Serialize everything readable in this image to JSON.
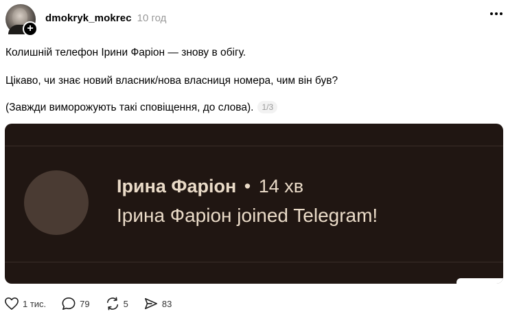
{
  "post": {
    "username": "dmokryk_mokrec",
    "timestamp": "10 год",
    "follow_symbol": "+",
    "lines": [
      "Колишній телефон Ірини Фаріон — знову в обігу.",
      "Цікаво, чи знає новий власник/нова власниця номера, чим він був?",
      "(Завжди виморожують такі сповіщення, до слова)."
    ],
    "pager": "1/3"
  },
  "media": {
    "notification": {
      "sender": "Ірина Фаріон",
      "separator": "•",
      "time": "14 хв",
      "message": "Ірина Фаріон joined Telegram!"
    }
  },
  "actions": {
    "likes": "1 тис.",
    "comments": "79",
    "reposts": "5",
    "shares": "83"
  },
  "icons": {
    "avatar": "user-avatar",
    "follow": "plus-icon",
    "more": "more-dots-icon",
    "like": "heart-icon",
    "comment": "comment-bubble-icon",
    "repost": "repost-icon",
    "share": "send-icon"
  }
}
